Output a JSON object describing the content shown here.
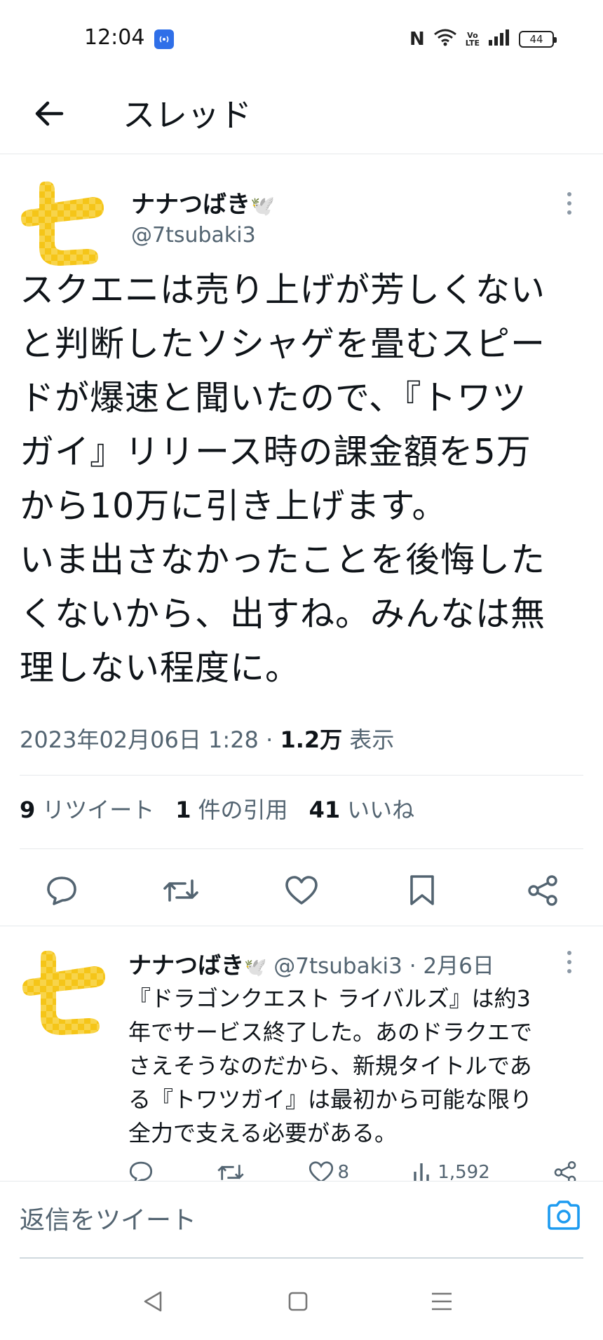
{
  "status_bar": {
    "time": "12:04",
    "battery": "44",
    "volte": "Vo\nLTE"
  },
  "header": {
    "title": "スレッド"
  },
  "main_tweet": {
    "display_name": "ナナつばき",
    "name_emoji": "🕊️",
    "handle": "@7tsubaki3",
    "text": "スクエニは売り上げが芳しくない\nと判断したソシャゲを畳むスピー\nドが爆速と聞いたので、『トワツ\nガイ』リリース時の課金額を5万\nから10万に引き上げます。\nいま出さなかったことを後悔した\nくないから、出すね。みんなは無\n理しない程度に。",
    "date": "2023年02月06日 1:28",
    "separator": " · ",
    "views_count": "1.2万",
    "views_label": "表示",
    "stats": {
      "retweets_count": "9",
      "retweets_label": "リツイート",
      "quotes_count": "1",
      "quotes_label": "件の引用",
      "likes_count": "41",
      "likes_label": "いいね"
    }
  },
  "reply_tweet": {
    "display_name": "ナナつばき",
    "name_emoji": "🕊️",
    "handle_date": " @7tsubaki3 · 2月6日",
    "text": "『ドラゴンクエスト ライバルズ』は約3\n年でサービス終了した。あのドラクエで\nさえそうなのだから、新規タイトルであ\nる『トワツガイ』は最初から可能な限り\n全力で支える必要がある。",
    "likes_count": "8",
    "views_count": "1,592"
  },
  "compose": {
    "placeholder": "返信をツイート"
  },
  "icons": {
    "back": "arrow-left-icon",
    "more": "more-vertical-icon",
    "reply": "comment-icon",
    "retweet": "retweet-icon",
    "like": "heart-icon",
    "bookmark": "bookmark-icon",
    "share": "share-icon",
    "camera": "camera-icon",
    "accent_color": "#1d9bf0",
    "avatar_color": "#f5c518"
  }
}
